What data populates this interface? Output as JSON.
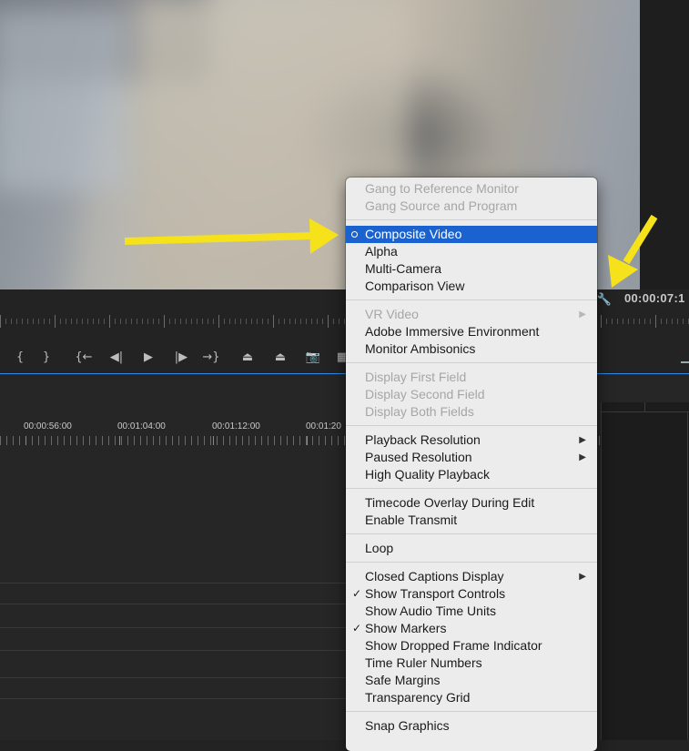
{
  "monitor": {
    "timecode": "00:00:07:1",
    "settings_icon": "wrench-icon"
  },
  "transport": {
    "buttons": [
      {
        "name": "mark-in-button",
        "glyph": "{"
      },
      {
        "name": "mark-out-button",
        "glyph": "}"
      },
      {
        "name": "go-to-in-button",
        "glyph": "{←"
      },
      {
        "name": "step-back-button",
        "glyph": "◀|"
      },
      {
        "name": "play-button",
        "glyph": "▶"
      },
      {
        "name": "step-forward-button",
        "glyph": "|▶"
      },
      {
        "name": "go-to-out-button",
        "glyph": "→}"
      },
      {
        "name": "lift-button",
        "glyph": "⏏"
      },
      {
        "name": "extract-button",
        "glyph": "⏏"
      },
      {
        "name": "export-frame-button",
        "glyph": "📷"
      },
      {
        "name": "comparison-view-button",
        "glyph": "▦"
      }
    ]
  },
  "timeline": {
    "ruler_labels": [
      "00:00:56:00",
      "00:01:04:00",
      "00:01:12:00",
      "00:01:20"
    ]
  },
  "menu": {
    "sections": [
      [
        {
          "label": "Gang to Reference Monitor",
          "disabled": true
        },
        {
          "label": "Gang Source and Program",
          "disabled": true
        }
      ],
      [
        {
          "label": "Composite Video",
          "selected": true,
          "radio": true
        },
        {
          "label": "Alpha"
        },
        {
          "label": "Multi-Camera"
        },
        {
          "label": "Comparison View"
        }
      ],
      [
        {
          "label": "VR Video",
          "disabled": true,
          "submenu": true
        },
        {
          "label": "Adobe Immersive Environment"
        },
        {
          "label": "Monitor Ambisonics"
        }
      ],
      [
        {
          "label": "Display First Field",
          "disabled": true
        },
        {
          "label": "Display Second Field",
          "disabled": true
        },
        {
          "label": "Display Both Fields",
          "disabled": true
        }
      ],
      [
        {
          "label": "Playback Resolution",
          "submenu": true
        },
        {
          "label": "Paused Resolution",
          "submenu": true
        },
        {
          "label": "High Quality Playback"
        }
      ],
      [
        {
          "label": "Timecode Overlay During Edit"
        },
        {
          "label": "Enable Transmit"
        }
      ],
      [
        {
          "label": "Loop"
        }
      ],
      [
        {
          "label": "Closed Captions Display",
          "submenu": true
        },
        {
          "label": "Show Transport Controls",
          "checked": true
        },
        {
          "label": "Show Audio Time Units"
        },
        {
          "label": "Show Markers",
          "checked": true
        },
        {
          "label": "Show Dropped Frame Indicator"
        },
        {
          "label": "Time Ruler Numbers"
        },
        {
          "label": "Safe Margins"
        },
        {
          "label": "Transparency Grid"
        }
      ],
      [
        {
          "label": "Snap Graphics"
        }
      ]
    ]
  },
  "annotations": {
    "arrow_color": "#f5e21b"
  }
}
